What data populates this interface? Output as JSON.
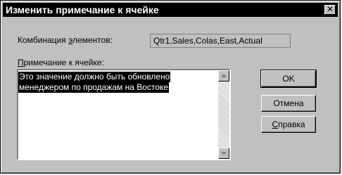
{
  "dialog": {
    "title": "Изменить примечание к ячейке",
    "close_glyph": "✕"
  },
  "combination": {
    "label_before": "Комбинация ",
    "label_mnemonic": "э",
    "label_after": "лементов:",
    "value": "Qtr1,Sales,Colas,East,Actual"
  },
  "note": {
    "label_mnemonic": "П",
    "label_after": "римечание к ячейке:",
    "lines": [
      "Это значение должно быть обновлено",
      "менеджером по продажам на Востоке"
    ]
  },
  "buttons": {
    "ok": "OK",
    "cancel": "Отмена",
    "help_mnemonic": "С",
    "help_after": "правка"
  },
  "icons": {
    "close": "close-icon",
    "scroll_up": "arrow-up-icon",
    "scroll_down": "arrow-down-icon"
  }
}
